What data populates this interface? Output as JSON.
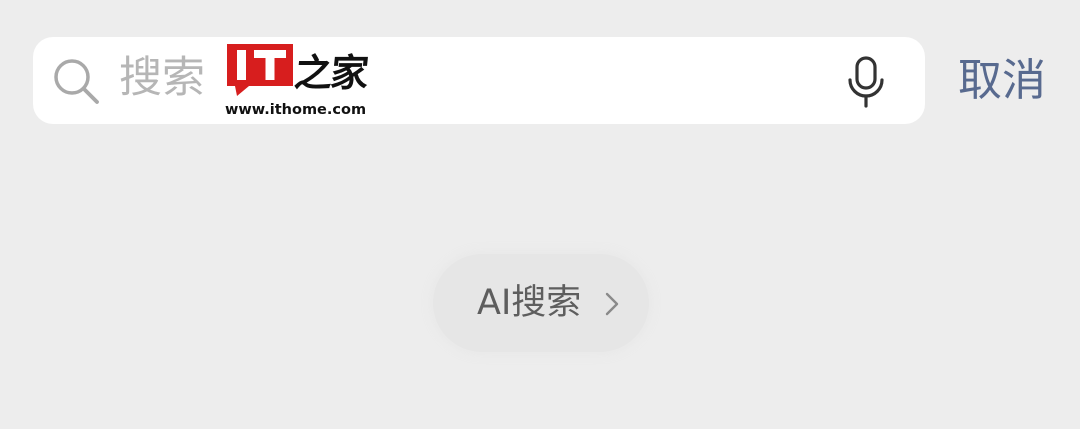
{
  "search_bar": {
    "search_icon": "search-icon",
    "placeholder": "搜索",
    "mic_icon": "microphone-icon"
  },
  "watermark": {
    "brand_text": "IT之家",
    "logo_letters": "IT",
    "url": "www.ithome.com",
    "logo_color": "#d71e1e"
  },
  "cancel_label": "取消",
  "ai_search": {
    "label": "AI搜索",
    "chevron_icon": "chevron-right-icon"
  },
  "colors": {
    "background": "#ededed",
    "search_bar": "#ffffff",
    "placeholder": "#b6b6b6",
    "cancel": "#586a8f",
    "ai_pill": "#e6e6e6",
    "ai_text": "#5e5e5e"
  }
}
